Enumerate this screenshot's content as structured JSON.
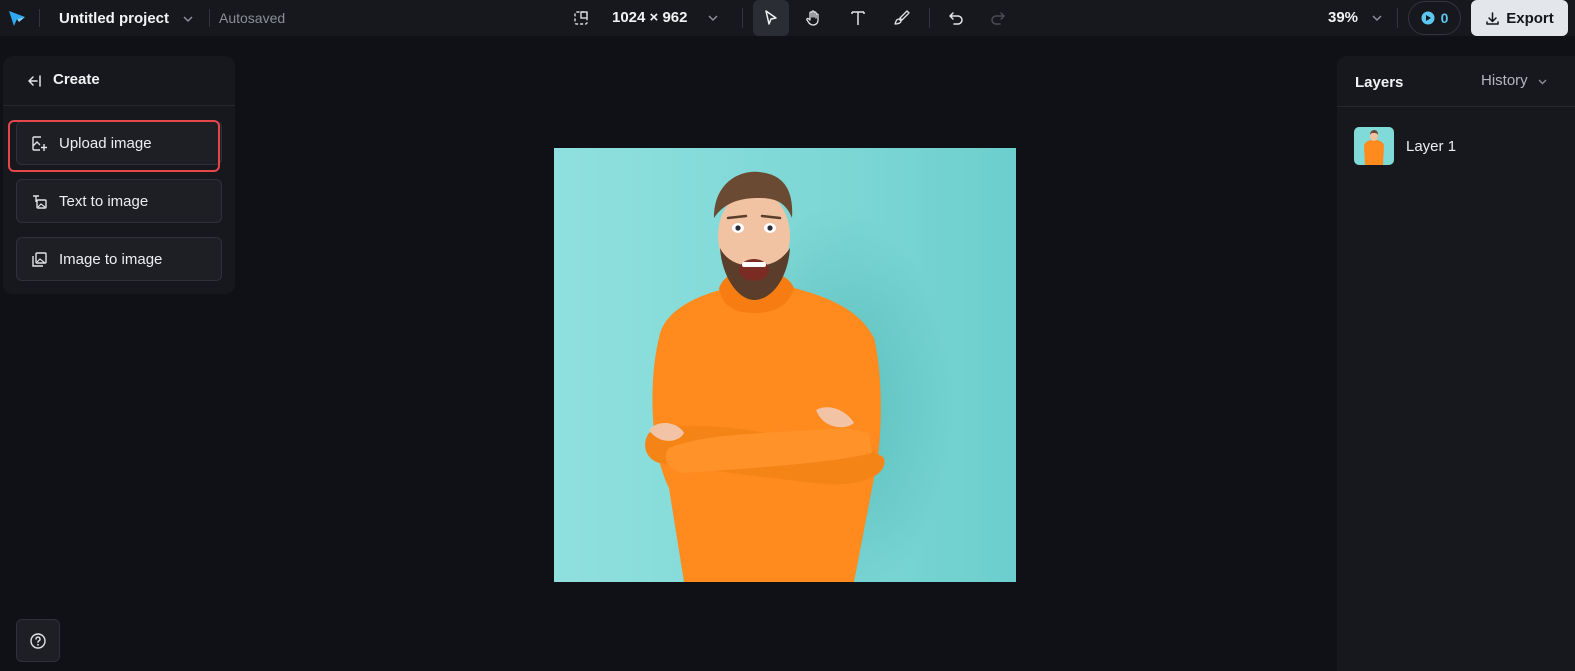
{
  "topbar": {
    "project_name": "Untitled project",
    "save_status": "Autosaved",
    "canvas_size": "1024 × 962",
    "tools": [
      {
        "name": "select-tool",
        "icon": "cursor-icon",
        "active": true
      },
      {
        "name": "hand-tool",
        "icon": "hand-icon",
        "active": false
      },
      {
        "name": "text-tool",
        "icon": "text-icon",
        "active": false
      },
      {
        "name": "brush-tool",
        "icon": "brush-icon",
        "active": false
      },
      {
        "name": "undo",
        "icon": "undo-icon",
        "active": false
      },
      {
        "name": "redo",
        "icon": "redo-icon",
        "active": false
      }
    ],
    "zoom": "39%",
    "credits": "0",
    "export_label": "Export"
  },
  "left_panel": {
    "title": "Create",
    "items": [
      {
        "label": "Upload image",
        "icon": "upload-image-icon",
        "highlighted": true
      },
      {
        "label": "Text to image",
        "icon": "text-to-image-icon",
        "highlighted": false
      },
      {
        "label": "Image to image",
        "icon": "image-to-image-icon",
        "highlighted": false
      }
    ]
  },
  "right_panel": {
    "tabs": {
      "layers": "Layers",
      "history": "History"
    },
    "layers": [
      {
        "name": "Layer 1"
      }
    ]
  },
  "colors": {
    "background": "#101116",
    "panel": "#17181d",
    "highlight": "#e3474a",
    "accent": "#5cc8f0",
    "image_background": "#7fdad8",
    "sweater": "#ff8a1e"
  }
}
